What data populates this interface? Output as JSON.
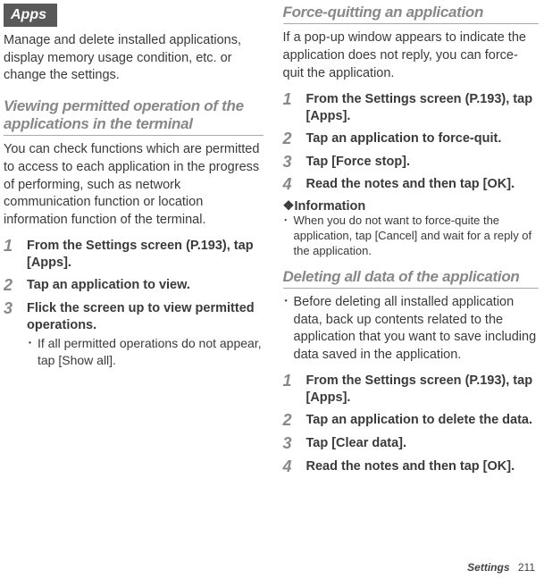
{
  "left": {
    "section_title": "Apps",
    "intro": "Manage and delete installed applications, display memory usage condition, etc. or change the settings.",
    "sub1_title": "Viewing permitted operation of the applications in the terminal",
    "sub1_desc": "You can check functions which are permitted to access to each application in the progress of performing, such as network communication function or location information function of the terminal.",
    "steps": [
      {
        "n": "1",
        "main": "From the Settings screen (P.193), tap [Apps]."
      },
      {
        "n": "2",
        "main": "Tap an application to view."
      },
      {
        "n": "3",
        "main": "Flick the screen up to view permitted operations.",
        "sub": "If all permitted operations do not appear, tap [Show all]."
      }
    ]
  },
  "right": {
    "sub2_title": "Force-quitting an application",
    "sub2_desc": "If a pop-up window appears to indicate the application does not reply, you can force-quit the application.",
    "steps2": [
      {
        "n": "1",
        "main": "From the Settings screen (P.193), tap [Apps]."
      },
      {
        "n": "2",
        "main": "Tap an application to force-quit."
      },
      {
        "n": "3",
        "main": "Tap [Force stop]."
      },
      {
        "n": "4",
        "main": "Read the notes and then tap [OK]."
      }
    ],
    "info_head": "❖Information",
    "info_text": "When you do not want to force-quite the application, tap [Cancel] and wait for a reply of the application.",
    "sub3_title": "Deleting all data of the application",
    "sub3_note": "Before deleting all installed application data, back up contents related to the application that you want to save including data saved in the application.",
    "steps3": [
      {
        "n": "1",
        "main": "From the Settings screen (P.193), tap [Apps]."
      },
      {
        "n": "2",
        "main": "Tap an application to delete the data."
      },
      {
        "n": "3",
        "main": "Tap [Clear data]."
      },
      {
        "n": "4",
        "main": "Read the notes and then tap [OK]."
      }
    ]
  },
  "footer": {
    "label": "Settings",
    "page": "211"
  }
}
